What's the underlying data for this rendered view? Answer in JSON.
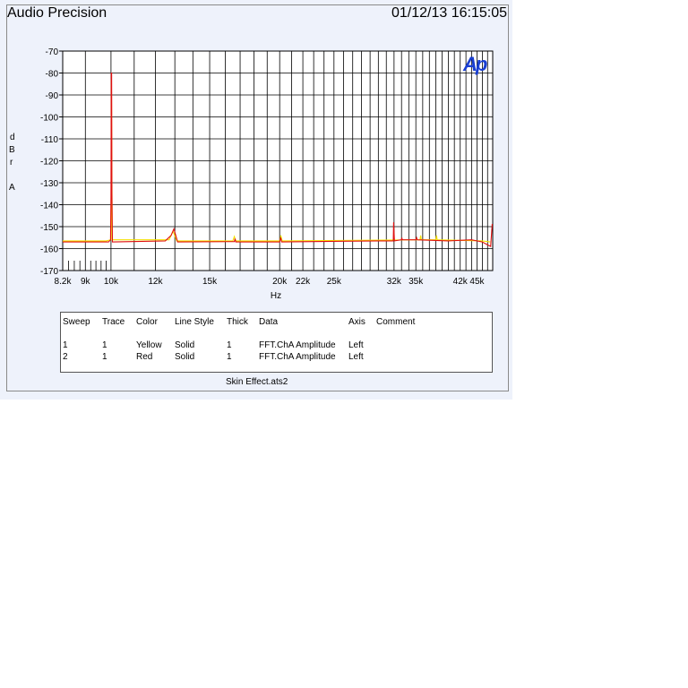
{
  "header": {
    "app_title": "Audio Precision",
    "timestamp": "01/12/13 16:15:05",
    "logo_text": "Ap"
  },
  "colors": {
    "panel_bg": "#eef2fb",
    "plot_bg": "#ffffff",
    "grid": "#000000",
    "series_red": "#e01010",
    "series_yellow": "#f5e000",
    "logo": "#1a3fd1"
  },
  "chart_data": {
    "type": "line",
    "xscale": "log",
    "xlim": [
      8200,
      48000
    ],
    "ylim": [
      -170,
      -70
    ],
    "xlabel": "Hz",
    "ylabel": "dBr A",
    "y_ticks": [
      -70,
      -80,
      -90,
      -100,
      -110,
      -120,
      -130,
      -140,
      -150,
      -160,
      -170
    ],
    "x_ticks": [
      {
        "v": 8200,
        "label": "8.2k"
      },
      {
        "v": 9000,
        "label": "9k"
      },
      {
        "v": 10000,
        "label": "10k"
      },
      {
        "v": 12000,
        "label": "12k"
      },
      {
        "v": 15000,
        "label": "15k"
      },
      {
        "v": 20000,
        "label": "20k"
      },
      {
        "v": 22000,
        "label": "22k"
      },
      {
        "v": 25000,
        "label": "25k"
      },
      {
        "v": 32000,
        "label": "32k"
      },
      {
        "v": 35000,
        "label": "35k"
      },
      {
        "v": 42000,
        "label": "42k"
      },
      {
        "v": 45000,
        "label": "45k"
      }
    ],
    "grid": true,
    "series": [
      {
        "name": "Yellow",
        "color": "#f5e000",
        "points": [
          [
            8200,
            -156.5
          ],
          [
            9800,
            -156.5
          ],
          [
            10000,
            -156
          ],
          [
            10020,
            -83
          ],
          [
            10050,
            -156
          ],
          [
            12700,
            -156
          ],
          [
            12900,
            -152
          ],
          [
            13100,
            -156.5
          ],
          [
            16500,
            -156.5
          ],
          [
            16600,
            -154.5
          ],
          [
            16700,
            -156.5
          ],
          [
            20000,
            -156.5
          ],
          [
            20100,
            -154
          ],
          [
            20200,
            -156.5
          ],
          [
            35600,
            -156
          ],
          [
            35700,
            -154
          ],
          [
            35800,
            -156
          ],
          [
            38000,
            -156
          ],
          [
            38100,
            -154
          ],
          [
            38200,
            -156
          ],
          [
            46000,
            -156.5
          ],
          [
            47500,
            -157
          ]
        ]
      },
      {
        "name": "Red",
        "color": "#e01010",
        "points": [
          [
            8200,
            -157
          ],
          [
            9000,
            -157
          ],
          [
            9900,
            -157
          ],
          [
            9980,
            -156
          ],
          [
            10000,
            -136
          ],
          [
            10010,
            -80
          ],
          [
            10025,
            -80
          ],
          [
            10035,
            -135
          ],
          [
            10060,
            -157
          ],
          [
            12500,
            -156.5
          ],
          [
            12800,
            -154
          ],
          [
            12950,
            -151
          ],
          [
            13050,
            -154
          ],
          [
            13150,
            -157
          ],
          [
            16600,
            -156.8
          ],
          [
            16650,
            -155.5
          ],
          [
            16700,
            -157
          ],
          [
            20000,
            -157
          ],
          [
            20080,
            -155
          ],
          [
            20160,
            -157
          ],
          [
            30000,
            -156.5
          ],
          [
            31900,
            -156.5
          ],
          [
            31950,
            -148
          ],
          [
            32050,
            -156.5
          ],
          [
            33000,
            -156
          ],
          [
            33050,
            -155
          ],
          [
            33100,
            -156
          ],
          [
            35000,
            -156
          ],
          [
            35100,
            -155
          ],
          [
            35200,
            -156
          ],
          [
            40000,
            -156.5
          ],
          [
            44000,
            -156
          ],
          [
            46000,
            -157
          ],
          [
            47600,
            -159
          ],
          [
            47900,
            -149
          ],
          [
            48000,
            -149
          ]
        ]
      }
    ]
  },
  "legend": {
    "headers": [
      "Sweep",
      "Trace",
      "Color",
      "Line Style",
      "Thick",
      "Data",
      "Axis",
      "Comment"
    ],
    "rows": [
      [
        "1",
        "1",
        "Yellow",
        "Solid",
        "1",
        "FFT.ChA Amplitude",
        "Left",
        ""
      ],
      [
        "2",
        "1",
        "Red",
        "Solid",
        "1",
        "FFT.ChA Amplitude",
        "Left",
        ""
      ]
    ]
  },
  "footer": {
    "filename": "Skin Effect.ats2"
  }
}
